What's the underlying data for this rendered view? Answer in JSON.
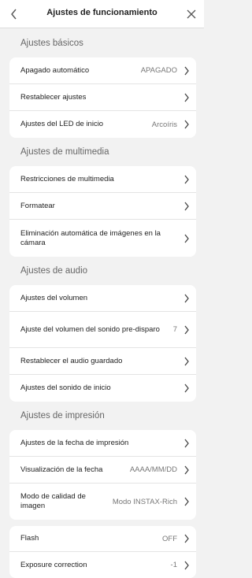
{
  "header": {
    "title": "Ajustes de funcionamiento"
  },
  "sections": {
    "basic": {
      "title": "Ajustes básicos",
      "items": [
        {
          "label": "Apagado automático",
          "value": "APAGADO"
        },
        {
          "label": "Restablecer ajustes",
          "value": ""
        },
        {
          "label": "Ajustes del LED de inicio",
          "value": "Arcoíris"
        }
      ]
    },
    "media": {
      "title": "Ajustes de multimedia",
      "items": [
        {
          "label": "Restricciones de multimedia",
          "value": ""
        },
        {
          "label": "Formatear",
          "value": ""
        },
        {
          "label": "Eliminación automática de imágenes en la cámara",
          "value": ""
        }
      ]
    },
    "audio": {
      "title": "Ajustes de audio",
      "items": [
        {
          "label": "Ajustes del volumen",
          "value": ""
        },
        {
          "label": "Ajuste del volumen del sonido pre-disparo",
          "value": "7"
        },
        {
          "label": "Restablecer el audio guardado",
          "value": ""
        },
        {
          "label": "Ajustes del sonido de inicio",
          "value": ""
        }
      ]
    },
    "print": {
      "title": "Ajustes de impresión",
      "items": [
        {
          "label": "Ajustes de la fecha de impresión",
          "value": ""
        },
        {
          "label": "Visualización de la fecha",
          "value": "AAAA/MM/DD"
        },
        {
          "label": "Modo de calidad de imagen",
          "value": "Modo INSTAX-Rich"
        }
      ]
    },
    "extra": {
      "items": [
        {
          "label": "Flash",
          "value": "OFF"
        },
        {
          "label": "Exposure correction",
          "value": "-1"
        }
      ]
    }
  }
}
